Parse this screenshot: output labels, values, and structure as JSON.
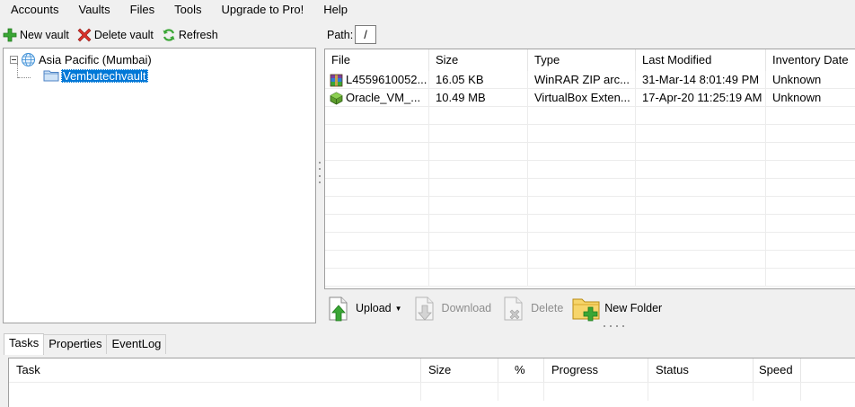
{
  "menu": [
    "Accounts",
    "Vaults",
    "Files",
    "Tools",
    "Upgrade to Pro!",
    "Help"
  ],
  "vault_toolbar": {
    "new_vault": "New vault",
    "delete_vault": "Delete vault",
    "refresh": "Refresh"
  },
  "tree": {
    "region": "Asia Pacific (Mumbai)",
    "vault": "Vembutechvault"
  },
  "path": {
    "label": "Path:",
    "value": "/"
  },
  "file_list": {
    "columns": [
      "File",
      "Size",
      "Type",
      "Last Modified",
      "Inventory Date"
    ],
    "rows": [
      {
        "file": "L4559610052...",
        "size": "16.05 KB",
        "type": "WinRAR ZIP arc...",
        "modified": "31-Mar-14 8:01:49 PM",
        "inventory": "Unknown",
        "icon": "winrar-archive-icon"
      },
      {
        "file": "Oracle_VM_...",
        "size": "10.49 MB",
        "type": "VirtualBox Exten...",
        "modified": "17-Apr-20 11:25:19 AM",
        "inventory": "Unknown",
        "icon": "virtualbox-extension-icon"
      }
    ]
  },
  "actions": {
    "upload": "Upload",
    "download": "Download",
    "delete": "Delete",
    "new_folder": "New Folder"
  },
  "tabs": [
    "Tasks",
    "Properties",
    "EventLog"
  ],
  "task_list": {
    "columns": [
      "Task",
      "Size",
      "%",
      "Progress",
      "Status",
      "Speed"
    ]
  },
  "colors": {
    "selection": "#0078d7",
    "add_green": "#3aa635",
    "delete_red": "#d9302a"
  }
}
